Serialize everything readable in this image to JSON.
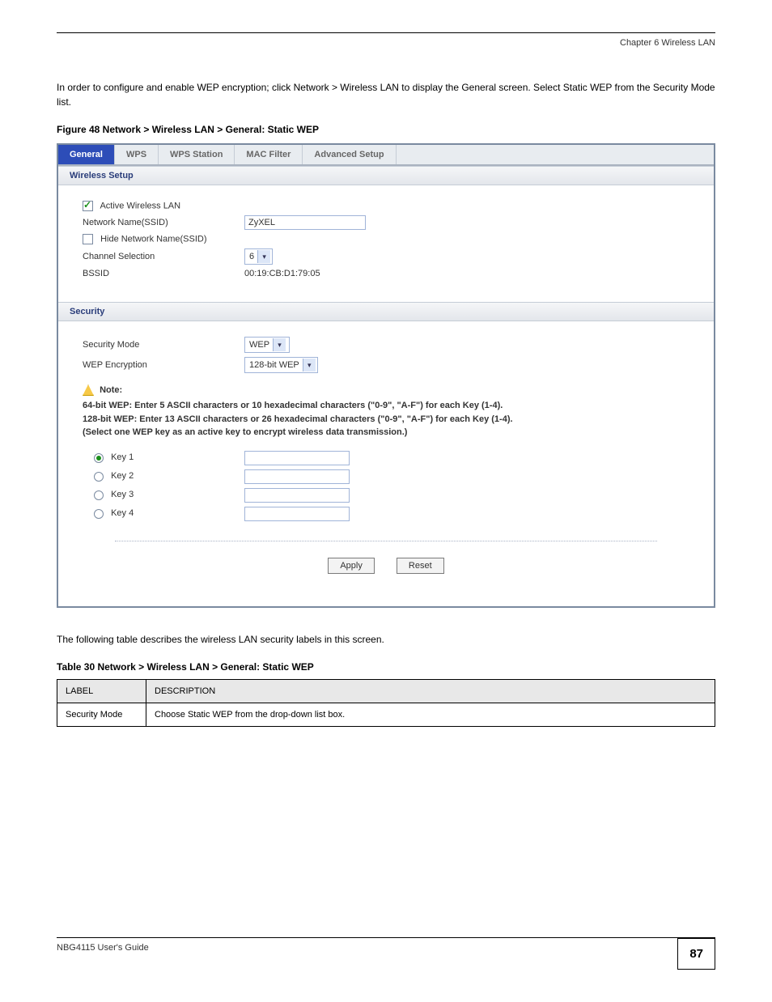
{
  "chapterHeader": " Chapter 6 Wireless LAN",
  "intro": "In order to configure and enable WEP encryption; click Network > Wireless LAN to display the General screen. Select Static WEP from the Security Mode list.",
  "figureTitle": "Figure 48   Network > Wireless LAN > General: Static WEP",
  "tabs": [
    {
      "label": "General",
      "active": true
    },
    {
      "label": "WPS",
      "active": false
    },
    {
      "label": "WPS Station",
      "active": false
    },
    {
      "label": "MAC Filter",
      "active": false
    },
    {
      "label": "Advanced Setup",
      "active": false
    }
  ],
  "wirelessSection": {
    "header": "Wireless Setup",
    "activeWirelessLabel": "Active Wireless LAN",
    "activeWirelessChecked": true,
    "ssidLabel": "Network Name(SSID)",
    "ssidValue": "ZyXEL",
    "hideSsidLabel": "Hide Network Name(SSID)",
    "hideSsidChecked": false,
    "channelLabel": "Channel Selection",
    "channelValue": "6",
    "bssidLabel": "BSSID",
    "bssidValue": "00:19:CB:D1:79:05"
  },
  "securitySection": {
    "header": "Security",
    "modeLabel": "Security Mode",
    "modeValue": "WEP",
    "wepEncLabel": "WEP Encryption",
    "wepEncValue": "128-bit WEP",
    "noteLabel": "Note:",
    "noteLine1": "64-bit WEP: Enter 5 ASCII characters or 10 hexadecimal characters (\"0-9\", \"A-F\") for each Key (1-4).",
    "noteLine2": "128-bit WEP: Enter 13 ASCII characters or 26 hexadecimal characters (\"0-9\", \"A-F\") for each Key (1-4).",
    "noteLine3": "(Select one WEP key as an active key to encrypt wireless data transmission.)",
    "keys": [
      {
        "label": "Key 1",
        "selected": true,
        "value": ""
      },
      {
        "label": "Key 2",
        "selected": false,
        "value": ""
      },
      {
        "label": "Key 3",
        "selected": false,
        "value": ""
      },
      {
        "label": "Key 4",
        "selected": false,
        "value": ""
      }
    ],
    "applyLabel": "Apply",
    "resetLabel": "Reset"
  },
  "postText": "The following table describes the wireless LAN security labels in this screen.",
  "tableTitle": "Table 30   Network > Wireless LAN > General: Static WEP",
  "table": {
    "headers": [
      "LABEL",
      "DESCRIPTION"
    ],
    "rows": [
      [
        "Security Mode",
        "Choose Static WEP from the drop-down list box."
      ]
    ]
  },
  "footerDoc": "NBG4115 User's Guide",
  "pageNum": "87"
}
